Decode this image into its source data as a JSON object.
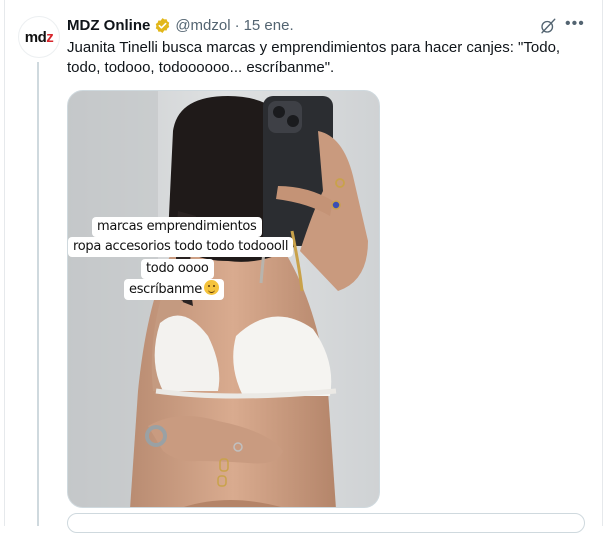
{
  "tweet": {
    "author_name": "MDZ Online",
    "handle": "@mdzol",
    "separator": "·",
    "date": "15 ene.",
    "text": "Juanita Tinelli busca marcas y emprendimientos para hacer canjes: \"Todo, todo, todooo, todoooooo... escríbanme\".",
    "avatar_text_main": "md",
    "avatar_text_accent": "z",
    "verified_color": "#e2b719",
    "icons": [
      "grok-icon",
      "more-icon",
      "verified-badge-icon"
    ]
  },
  "media": {
    "captions": [
      "marcas emprendimientos",
      "ropa accesorios todo todo todoooll",
      "todo oooo",
      "escríbanme"
    ]
  }
}
